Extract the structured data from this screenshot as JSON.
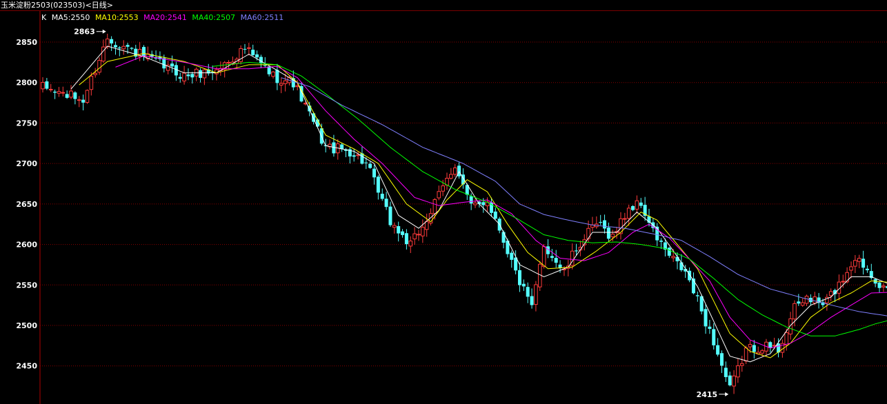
{
  "window": {
    "title": "玉米淀粉2503(023503)<日线>"
  },
  "legend": {
    "k_label": "K",
    "ma5": "MA5:2550",
    "ma10": "MA10:2553",
    "ma20": "MA20:2541",
    "ma40": "MA40:2507",
    "ma60": "MA60:2511"
  },
  "colors": {
    "up": "#ff3b3b",
    "down": "#54ffff",
    "ma5": "#ffffff",
    "ma10": "#ffff00",
    "ma20": "#ff00ff",
    "ma40": "#00ff00",
    "ma60": "#8080ff",
    "grid": "#8b0000",
    "axis_text": "#ffffff"
  },
  "chart_data": {
    "type": "candlestick",
    "ylim": [
      2410,
      2885
    ],
    "yticks": [
      2450,
      2500,
      2550,
      2600,
      2650,
      2700,
      2750,
      2800,
      2850
    ],
    "grid": "horizontal-dotted",
    "annotations": [
      {
        "label": "2863",
        "value": 2863,
        "bar": 16,
        "side": "left"
      },
      {
        "label": "2415",
        "value": 2415,
        "bar": 170,
        "side": "left"
      }
    ],
    "close_path": [
      [
        0,
        2794
      ],
      [
        10,
        2778
      ],
      [
        16,
        2855
      ],
      [
        25,
        2832
      ],
      [
        35,
        2808
      ],
      [
        43,
        2815
      ],
      [
        50,
        2842
      ],
      [
        57,
        2808
      ],
      [
        62,
        2800
      ],
      [
        70,
        2720
      ],
      [
        76,
        2715
      ],
      [
        80,
        2700
      ],
      [
        86,
        2628
      ],
      [
        91,
        2598
      ],
      [
        96,
        2640
      ],
      [
        102,
        2700
      ],
      [
        106,
        2645
      ],
      [
        110,
        2655
      ],
      [
        113,
        2620
      ],
      [
        117,
        2565
      ],
      [
        121,
        2520
      ],
      [
        124,
        2600
      ],
      [
        129,
        2565
      ],
      [
        132,
        2595
      ],
      [
        137,
        2625
      ],
      [
        141,
        2610
      ],
      [
        145,
        2645
      ],
      [
        148,
        2650
      ],
      [
        151,
        2615
      ],
      [
        155,
        2585
      ],
      [
        159,
        2565
      ],
      [
        162,
        2530
      ],
      [
        166,
        2480
      ],
      [
        170,
        2420
      ],
      [
        174,
        2470
      ],
      [
        178,
        2475
      ],
      [
        182,
        2470
      ],
      [
        186,
        2520
      ],
      [
        189,
        2535
      ],
      [
        193,
        2525
      ],
      [
        197,
        2550
      ],
      [
        201,
        2585
      ],
      [
        205,
        2565
      ],
      [
        208,
        2545
      ],
      [
        210,
        2534
      ]
    ],
    "series": [
      {
        "name": "MA5",
        "value": 2550,
        "anchors": [
          [
            7,
            2792
          ],
          [
            16,
            2845
          ],
          [
            25,
            2832
          ],
          [
            35,
            2812
          ],
          [
            43,
            2812
          ],
          [
            51,
            2835
          ],
          [
            58,
            2815
          ],
          [
            63,
            2800
          ],
          [
            70,
            2722
          ],
          [
            77,
            2715
          ],
          [
            82,
            2700
          ],
          [
            88,
            2636
          ],
          [
            93,
            2620
          ],
          [
            98,
            2642
          ],
          [
            103,
            2690
          ],
          [
            108,
            2650
          ],
          [
            113,
            2625
          ],
          [
            118,
            2575
          ],
          [
            124,
            2560
          ],
          [
            130,
            2572
          ],
          [
            136,
            2615
          ],
          [
            142,
            2615
          ],
          [
            147,
            2640
          ],
          [
            152,
            2620
          ],
          [
            157,
            2585
          ],
          [
            162,
            2548
          ],
          [
            166,
            2505
          ],
          [
            170,
            2462
          ],
          [
            175,
            2455
          ],
          [
            180,
            2465
          ],
          [
            185,
            2500
          ],
          [
            190,
            2525
          ],
          [
            195,
            2535
          ],
          [
            200,
            2560
          ],
          [
            205,
            2560
          ],
          [
            210,
            2550
          ]
        ]
      },
      {
        "name": "MA10",
        "value": 2553,
        "anchors": [
          [
            9,
            2797
          ],
          [
            16,
            2826
          ],
          [
            25,
            2836
          ],
          [
            35,
            2826
          ],
          [
            43,
            2812
          ],
          [
            51,
            2822
          ],
          [
            58,
            2822
          ],
          [
            63,
            2800
          ],
          [
            70,
            2735
          ],
          [
            77,
            2718
          ],
          [
            83,
            2700
          ],
          [
            90,
            2650
          ],
          [
            96,
            2628
          ],
          [
            100,
            2655
          ],
          [
            105,
            2680
          ],
          [
            110,
            2665
          ],
          [
            115,
            2625
          ],
          [
            120,
            2590
          ],
          [
            125,
            2570
          ],
          [
            131,
            2572
          ],
          [
            137,
            2592
          ],
          [
            143,
            2615
          ],
          [
            148,
            2640
          ],
          [
            152,
            2630
          ],
          [
            157,
            2600
          ],
          [
            162,
            2570
          ],
          [
            166,
            2530
          ],
          [
            170,
            2490
          ],
          [
            175,
            2468
          ],
          [
            180,
            2460
          ],
          [
            185,
            2478
          ],
          [
            190,
            2510
          ],
          [
            195,
            2528
          ],
          [
            200,
            2540
          ],
          [
            205,
            2555
          ],
          [
            210,
            2553
          ]
        ]
      },
      {
        "name": "MA20",
        "value": 2541,
        "anchors": [
          [
            18,
            2819
          ],
          [
            25,
            2833
          ],
          [
            35,
            2825
          ],
          [
            43,
            2817
          ],
          [
            51,
            2817
          ],
          [
            58,
            2820
          ],
          [
            63,
            2806
          ],
          [
            70,
            2765
          ],
          [
            77,
            2730
          ],
          [
            84,
            2700
          ],
          [
            92,
            2658
          ],
          [
            98,
            2648
          ],
          [
            104,
            2652
          ],
          [
            110,
            2655
          ],
          [
            116,
            2638
          ],
          [
            122,
            2605
          ],
          [
            128,
            2583
          ],
          [
            134,
            2580
          ],
          [
            140,
            2590
          ],
          [
            146,
            2615
          ],
          [
            150,
            2625
          ],
          [
            155,
            2608
          ],
          [
            160,
            2582
          ],
          [
            165,
            2555
          ],
          [
            170,
            2510
          ],
          [
            175,
            2482
          ],
          [
            180,
            2472
          ],
          [
            185,
            2478
          ],
          [
            190,
            2492
          ],
          [
            195,
            2510
          ],
          [
            200,
            2525
          ],
          [
            205,
            2540
          ],
          [
            210,
            2541
          ]
        ]
      },
      {
        "name": "MA40",
        "value": 2507,
        "anchors": [
          [
            42,
            2820
          ],
          [
            51,
            2825
          ],
          [
            58,
            2822
          ],
          [
            64,
            2808
          ],
          [
            70,
            2786
          ],
          [
            78,
            2755
          ],
          [
            86,
            2720
          ],
          [
            94,
            2690
          ],
          [
            102,
            2668
          ],
          [
            110,
            2652
          ],
          [
            118,
            2630
          ],
          [
            124,
            2612
          ],
          [
            130,
            2605
          ],
          [
            136,
            2602
          ],
          [
            142,
            2603
          ],
          [
            148,
            2600
          ],
          [
            154,
            2595
          ],
          [
            160,
            2582
          ],
          [
            166,
            2558
          ],
          [
            172,
            2532
          ],
          [
            178,
            2513
          ],
          [
            184,
            2498
          ],
          [
            190,
            2487
          ],
          [
            196,
            2487
          ],
          [
            202,
            2495
          ],
          [
            206,
            2502
          ],
          [
            210,
            2507
          ]
        ]
      },
      {
        "name": "MA60",
        "value": 2511,
        "anchors": [
          [
            59,
            2806
          ],
          [
            66,
            2795
          ],
          [
            74,
            2772
          ],
          [
            84,
            2748
          ],
          [
            94,
            2720
          ],
          [
            104,
            2700
          ],
          [
            112,
            2678
          ],
          [
            118,
            2650
          ],
          [
            124,
            2637
          ],
          [
            130,
            2630
          ],
          [
            136,
            2624
          ],
          [
            144,
            2620
          ],
          [
            152,
            2612
          ],
          [
            158,
            2605
          ],
          [
            165,
            2585
          ],
          [
            172,
            2563
          ],
          [
            180,
            2545
          ],
          [
            188,
            2534
          ],
          [
            196,
            2524
          ],
          [
            202,
            2517
          ],
          [
            210,
            2511
          ]
        ]
      }
    ]
  }
}
